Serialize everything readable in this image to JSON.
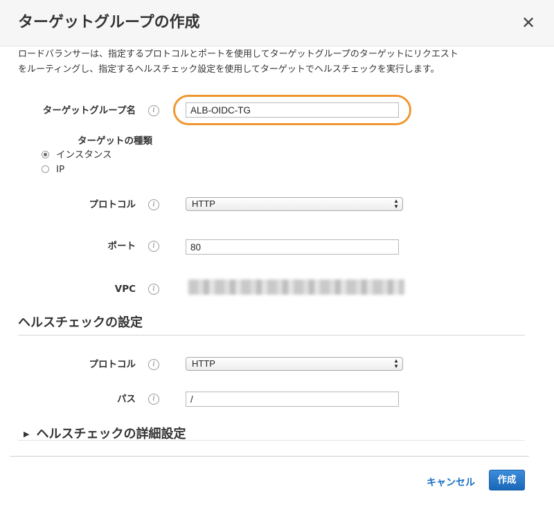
{
  "dialog": {
    "title": "ターゲットグループの作成",
    "close_symbol": "✕",
    "description_lines": [
      "ロードバランサーは、指定するプロトコルとポートを使用してターゲットグループのターゲットにリクエスト",
      "をルーティングし、指定するヘルスチェック設定を使用してターゲットでヘルスチェックを実行します。"
    ]
  },
  "form": {
    "target_group_name": {
      "label": "ターゲットグループ名",
      "value": "ALB-OIDC-TG"
    },
    "target_type": {
      "label": "ターゲットの種類",
      "options": [
        {
          "label": "インスタンス",
          "selected": true
        },
        {
          "label": "IP",
          "selected": false
        }
      ]
    },
    "protocol": {
      "label": "プロトコル",
      "value": "HTTP"
    },
    "port": {
      "label": "ポート",
      "value": "80"
    },
    "vpc": {
      "label": "VPC"
    }
  },
  "health_check": {
    "section_title": "ヘルスチェックの設定",
    "protocol": {
      "label": "プロトコル",
      "value": "HTTP"
    },
    "path": {
      "label": "パス",
      "value": "/"
    },
    "advanced_label": "ヘルスチェックの詳細設定"
  },
  "footer": {
    "cancel_label": "キャンセル",
    "create_label": "作成"
  },
  "colors": {
    "accent": "#1a6fc4",
    "highlight": "#f0962e",
    "header_bg": "#f6f6f6"
  },
  "icons": [
    "close-icon",
    "info-icon",
    "triangle-right-icon",
    "select-arrows-icon"
  ]
}
